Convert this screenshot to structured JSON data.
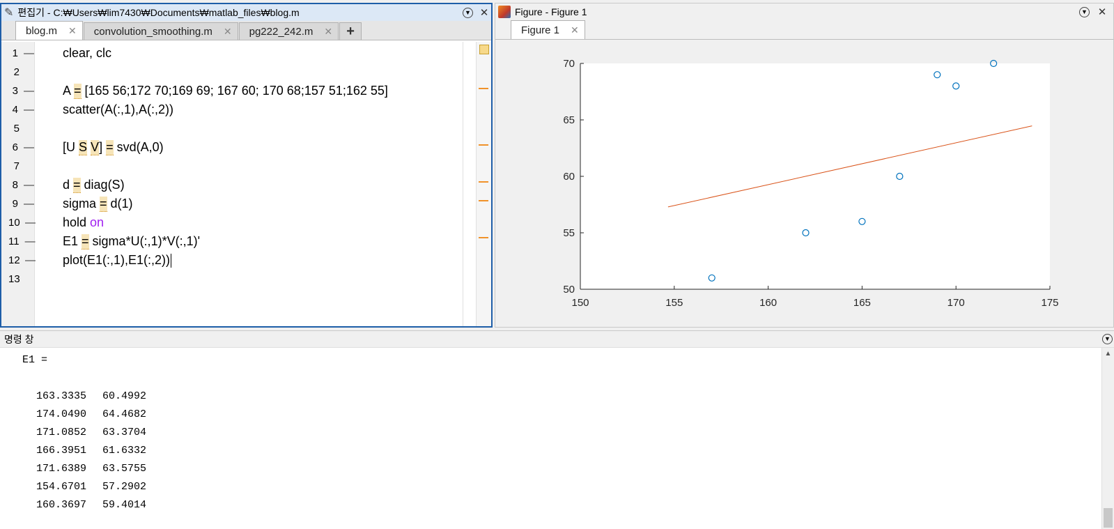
{
  "editor": {
    "title": "편집기 - C:₩Users₩lim7430₩Documents₩matlab_files₩blog.m",
    "tabs": [
      {
        "label": "blog.m",
        "active": true
      },
      {
        "label": "convolution_smoothing.m",
        "active": false
      },
      {
        "label": "pg222_242.m",
        "active": false
      }
    ],
    "add_tab": "+",
    "line_numbers": [
      "1",
      "2",
      "3",
      "4",
      "5",
      "6",
      "7",
      "8",
      "9",
      "10",
      "11",
      "12",
      "13"
    ],
    "code": {
      "l1": "clear, clc",
      "l3a": "A ",
      "l3eq": "=",
      "l3b": " [165 56;172 70;169 69; 167 60; 170 68;157 51;162 55]",
      "l4": "scatter(A(:,1),A(:,2))",
      "l6a": "[U ",
      "l6s": "S",
      "l6sp": " ",
      "l6v": "V",
      "l6b": "] ",
      "l6eq": "=",
      "l6c": " svd(A,0)",
      "l8a": "d ",
      "l8eq": "=",
      "l8b": " diag(S)",
      "l9a": "sigma ",
      "l9eq": "=",
      "l9b": " d(1)",
      "l10a": "hold ",
      "l10kw": "on",
      "l11a": "E1 ",
      "l11eq": "=",
      "l11b": " sigma*U(:,1)*V(:,1)'",
      "l12": "plot(E1(:,1),E1(:,2))"
    }
  },
  "figure": {
    "title": "Figure - Figure 1",
    "tab": "Figure 1"
  },
  "chart_data": {
    "type": "scatter",
    "xlim": [
      150,
      175
    ],
    "ylim": [
      50,
      70
    ],
    "xticks": [
      150,
      155,
      160,
      165,
      170,
      175
    ],
    "yticks": [
      50,
      55,
      60,
      65,
      70
    ],
    "scatter": {
      "x": [
        165,
        172,
        169,
        167,
        170,
        157,
        162
      ],
      "y": [
        56,
        70,
        69,
        60,
        68,
        51,
        55
      ],
      "color": "#0072bd"
    },
    "line": {
      "x": [
        154.6701,
        174.049
      ],
      "y": [
        57.2902,
        64.4682
      ],
      "color": "#d95319"
    },
    "grid": false
  },
  "command_window": {
    "title": "명령 창",
    "var_label": "E1 =",
    "rows": [
      [
        "163.3335",
        "60.4992"
      ],
      [
        "174.0490",
        "64.4682"
      ],
      [
        "171.0852",
        "63.3704"
      ],
      [
        "166.3951",
        "61.6332"
      ],
      [
        "171.6389",
        "63.5755"
      ],
      [
        "154.6701",
        "57.2902"
      ],
      [
        "160.3697",
        "59.4014"
      ]
    ]
  }
}
